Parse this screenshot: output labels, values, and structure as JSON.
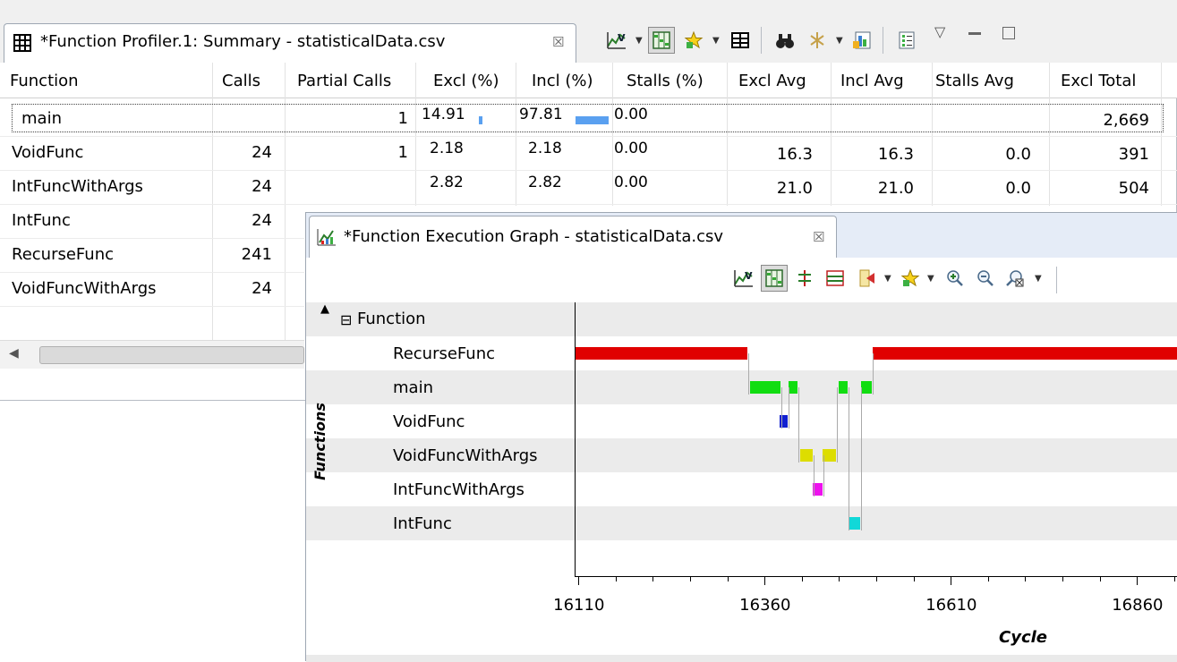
{
  "summary": {
    "tab_title": "*Function Profiler.1: Summary - statisticalData.csv",
    "tab_close": "☒",
    "columns": [
      "Function",
      "Calls",
      "Partial Calls",
      "Excl (%)",
      "Incl (%)",
      "Stalls (%)",
      "Excl Avg",
      "Incl Avg",
      "Stalls Avg",
      "Excl Total"
    ],
    "rows": [
      {
        "function": "main",
        "calls": "",
        "partial_calls": "1",
        "excl_pct": "14.91",
        "incl_pct": "97.81",
        "stalls_pct": "0.00",
        "excl_avg": "",
        "incl_avg": "",
        "stalls_avg": "",
        "excl_total": "2,669",
        "excl_bar": 0.1491,
        "incl_bar": 0.9781,
        "selected": true
      },
      {
        "function": "VoidFunc",
        "calls": "24",
        "partial_calls": "1",
        "excl_pct": "2.18",
        "incl_pct": "2.18",
        "stalls_pct": "0.00",
        "excl_avg": "16.3",
        "incl_avg": "16.3",
        "stalls_avg": "0.0",
        "excl_total": "391"
      },
      {
        "function": "IntFuncWithArgs",
        "calls": "24",
        "partial_calls": "",
        "excl_pct": "2.82",
        "incl_pct": "2.82",
        "stalls_pct": "0.00",
        "excl_avg": "21.0",
        "incl_avg": "21.0",
        "stalls_avg": "0.0",
        "excl_total": "504"
      },
      {
        "function": "IntFunc",
        "calls": "24"
      },
      {
        "function": "RecurseFunc",
        "calls": "241"
      },
      {
        "function": "VoidFuncWithArgs",
        "calls": "24"
      }
    ],
    "toolbar_icons": [
      "chart-icon",
      "tree-icon",
      "star-icon",
      "table-icon",
      "binoculars-icon",
      "filter-icon",
      "export-icon",
      "columns-icon"
    ],
    "window_controls": [
      "view-menu-icon",
      "minimize-icon",
      "maximize-icon"
    ]
  },
  "graph": {
    "tab_title": "*Function Execution Graph - statisticalData.csv",
    "tab_close": "☒",
    "group_label": "Function",
    "group_toggle": "⊟",
    "collapse_arrow": "▲",
    "y_axis_title": "Functions",
    "x_axis_title": "Cycle",
    "functions": [
      "RecurseFunc",
      "main",
      "VoidFunc",
      "VoidFuncWithArgs",
      "IntFuncWithArgs",
      "IntFunc"
    ],
    "x_ticks": [
      "16110",
      "16360",
      "16610",
      "16860"
    ],
    "toolbar_icons": [
      "chart-icon",
      "tree-icon",
      "marker-icon",
      "range-icon",
      "goto-icon",
      "star-icon",
      "zoom-in-icon",
      "zoom-out-icon",
      "zoom-fit-icon"
    ],
    "colors": {
      "RecurseFunc": "#e00000",
      "main": "#11dd11",
      "VoidFunc": "#1020d0",
      "VoidFuncWithArgs": "#dddd00",
      "IntFuncWithArgs": "#ee11ee",
      "IntFunc": "#11d8d8"
    }
  },
  "chart_data": {
    "type": "timeline",
    "x_axis": "Cycle",
    "y_axis": "Functions",
    "xlim": [
      16105,
      16915
    ],
    "x_ticks": [
      16110,
      16360,
      16610,
      16860
    ],
    "categories": [
      "RecurseFunc",
      "main",
      "VoidFunc",
      "VoidFuncWithArgs",
      "IntFuncWithArgs",
      "IntFunc"
    ],
    "segments": [
      {
        "function": "RecurseFunc",
        "start": 16105,
        "end": 16337
      },
      {
        "function": "main",
        "start": 16340,
        "end": 16381
      },
      {
        "function": "main",
        "start": 16392,
        "end": 16404
      },
      {
        "function": "VoidFunc",
        "start": 16380,
        "end": 16391
      },
      {
        "function": "main",
        "start": 16460,
        "end": 16471
      },
      {
        "function": "main",
        "start": 16490,
        "end": 16504
      },
      {
        "function": "VoidFuncWithArgs",
        "start": 16408,
        "end": 16425
      },
      {
        "function": "IntFuncWithArgs",
        "start": 16425,
        "end": 16438
      },
      {
        "function": "VoidFuncWithArgs",
        "start": 16438,
        "end": 16456
      },
      {
        "function": "IntFunc",
        "start": 16474,
        "end": 16488
      },
      {
        "function": "RecurseFunc",
        "start": 16505,
        "end": 16915
      }
    ]
  }
}
